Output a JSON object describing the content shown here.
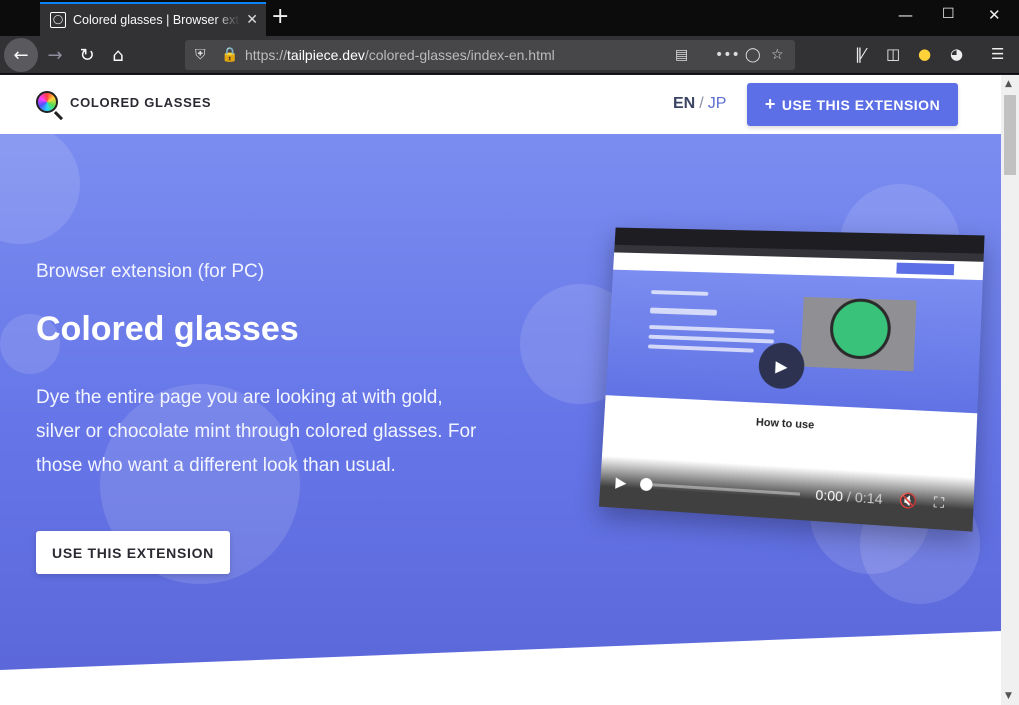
{
  "browser": {
    "tab_title": "Colored glasses | Browser extension",
    "url_protocol": "https://",
    "url_host": "tailpiece.dev",
    "url_path": "/colored-glasses/index-en.html"
  },
  "site": {
    "logo_text": "COLORED GLASSES",
    "lang_en": "EN",
    "lang_sep": "/",
    "lang_jp": "JP",
    "header_cta": "USE THIS EXTENSION"
  },
  "hero": {
    "eyebrow": "Browser extension (for PC)",
    "title": "Colored glasses",
    "description": "Dye the entire page you are looking at with gold, silver or chocolate mint through colored glasses. For those who want a different look than usual.",
    "cta": "USE THIS EXTENSION"
  },
  "video": {
    "section_label": "How to use",
    "time_current": "0:00",
    "time_sep": " / ",
    "time_total": "0:14",
    "progress": 0
  },
  "colors": {
    "accent": "#5c6fe6",
    "hero_top": "#7b8df0",
    "hero_bottom": "#5a66d8",
    "tab_highlight": "#0a84ff"
  }
}
